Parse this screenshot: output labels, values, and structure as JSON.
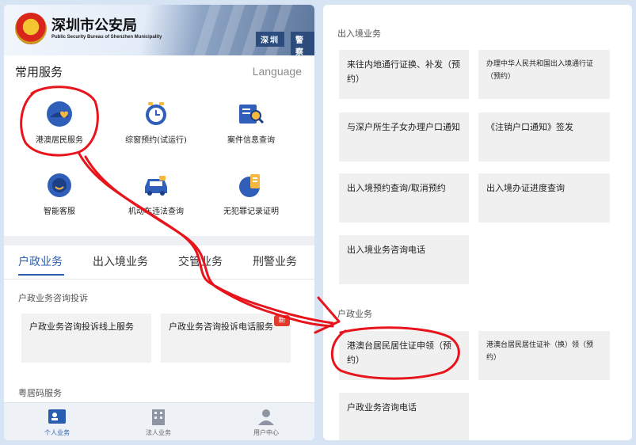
{
  "left": {
    "header": {
      "title": "深圳市公安局",
      "subtitle": "Public Security Bureau of Shenzhen Municipality",
      "sign_1": "深圳",
      "sign_2": "警察"
    },
    "services": {
      "title": "常用服务",
      "language": "Language",
      "items": [
        {
          "label": "港澳居民服务",
          "icon": "helmet-heart-icon"
        },
        {
          "label": "综窗预约(试运行)",
          "icon": "clock-icon"
        },
        {
          "label": "案件信息查询",
          "icon": "book-search-icon"
        },
        {
          "label": "智能客服",
          "icon": "robot-icon"
        },
        {
          "label": "机动车违法查询",
          "icon": "car-icon"
        },
        {
          "label": "无犯罪记录证明",
          "icon": "document-icon"
        }
      ]
    },
    "tabs": [
      "户政业务",
      "出入境业务",
      "交管业务",
      "刑警业务"
    ],
    "sections": {
      "consult": "户政业务咨询投诉",
      "residence_code": "粤居码服务"
    },
    "cards": [
      "户政业务咨询投诉线上服务",
      "户政业务咨询投诉电话服务"
    ],
    "badge_new": "新",
    "bottom_nav": [
      {
        "label": "个人业务",
        "icon": "person-card-icon"
      },
      {
        "label": "法人业务",
        "icon": "building-icon"
      },
      {
        "label": "用户中心",
        "icon": "user-icon"
      }
    ]
  },
  "right": {
    "section_exit_entry": "出入境业务",
    "exit_entry_cards": [
      "来往内地通行证换、补发（预约）",
      "办理中华人民共和国出入境通行证（预约）",
      "与深户所生子女办理户口通知",
      "《注销户口通知》签发",
      "出入境预约查询/取消预约",
      "出入境办证进度查询",
      "出入境业务咨询电话"
    ],
    "section_household": "户政业务",
    "household_cards": [
      "港澳台居民居住证申领（预约）",
      "港澳台居民居住证补（换）领（预约）",
      "户政业务咨询电话"
    ]
  },
  "colors": {
    "accent_blue": "#2a5db0",
    "annotation_red": "#e8141c",
    "badge_red": "#e23b2e"
  }
}
